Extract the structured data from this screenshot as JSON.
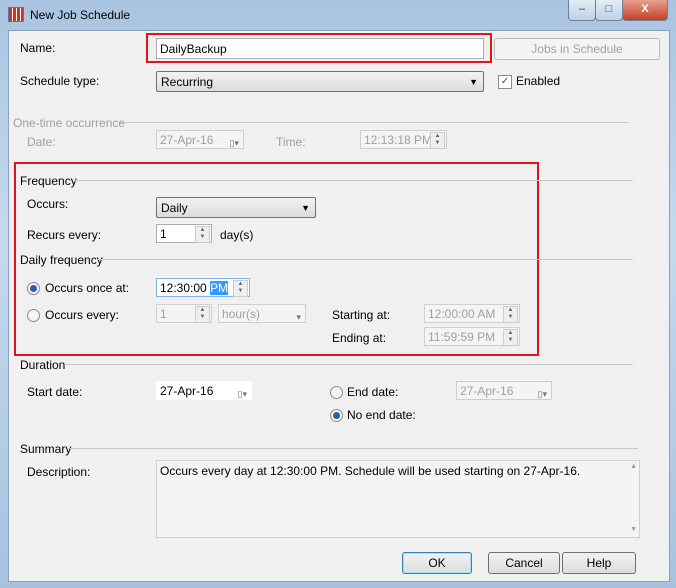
{
  "window": {
    "title": "New Job Schedule",
    "minimize": "–",
    "maximize": "□",
    "close": "X"
  },
  "name": {
    "label": "Name:",
    "value": "DailyBackup"
  },
  "jobs_button": "Jobs in Schedule",
  "schedule_type": {
    "label": "Schedule type:",
    "value": "Recurring"
  },
  "enabled": {
    "label": "Enabled",
    "checked": true
  },
  "one_time": {
    "header": "One-time occurrence",
    "date_label": "Date:",
    "date": "27-Apr-16",
    "time_label": "Time:",
    "time": "12:13:18 PM"
  },
  "frequency": {
    "header": "Frequency",
    "occurs_label": "Occurs:",
    "occurs": "Daily",
    "recurs_label": "Recurs every:",
    "recurs": "1",
    "recurs_unit": "day(s)"
  },
  "daily": {
    "header": "Daily frequency",
    "once_label": "Occurs once at:",
    "once_time": "12:30:00",
    "once_ampm": "PM",
    "every_label": "Occurs every:",
    "every_value": "1",
    "every_unit": "hour(s)",
    "start_label": "Starting at:",
    "start": "12:00:00 AM",
    "end_label": "Ending at:",
    "end": "11:59:59 PM"
  },
  "duration": {
    "header": "Duration",
    "start_label": "Start date:",
    "start": "27-Apr-16",
    "end_label": "End date:",
    "end": "27-Apr-16",
    "noend_label": "No end date:"
  },
  "summary": {
    "header": "Summary",
    "desc_label": "Description:",
    "desc": "Occurs every day at 12:30:00 PM. Schedule will be used starting on 27-Apr-16."
  },
  "buttons": {
    "ok": "OK",
    "cancel": "Cancel",
    "help": "Help"
  }
}
